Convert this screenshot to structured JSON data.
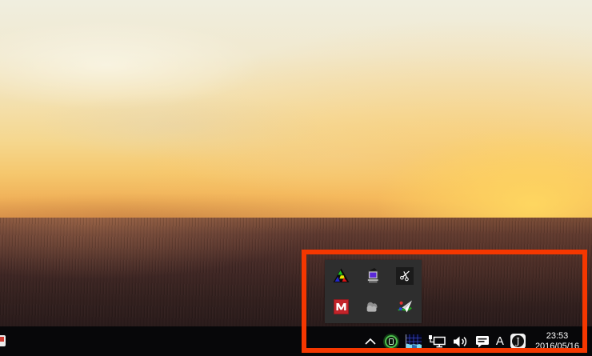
{
  "wallpaper": {
    "name": "sunset-over-grassland"
  },
  "annotation": {
    "type": "highlight-rectangle",
    "color": "#f53700"
  },
  "tray_popup": {
    "background": "#2e2e2e",
    "icons": [
      {
        "name": "multicolor-triangle-icon"
      },
      {
        "name": "monitor-purple-screen-icon"
      },
      {
        "name": "scissors-icon"
      },
      {
        "name": "adobe-red-icon"
      },
      {
        "name": "cloud-gray-icon"
      },
      {
        "name": "colorful-arrow-icon"
      }
    ]
  },
  "taskbar": {
    "background": "#070709",
    "ime_mode": "A",
    "clock": {
      "time": "23:53",
      "date": "2016/05/16"
    },
    "tray_icons": [
      {
        "name": "show-hidden-icons-chevron"
      },
      {
        "name": "green-ring-app-icon"
      },
      {
        "name": "performance-graph-app-icon"
      },
      {
        "name": "network-wired-icon"
      },
      {
        "name": "volume-icon"
      },
      {
        "name": "message-bubble-icon"
      },
      {
        "name": "ime-mode-indicator"
      },
      {
        "name": "j-app-icon"
      }
    ]
  }
}
